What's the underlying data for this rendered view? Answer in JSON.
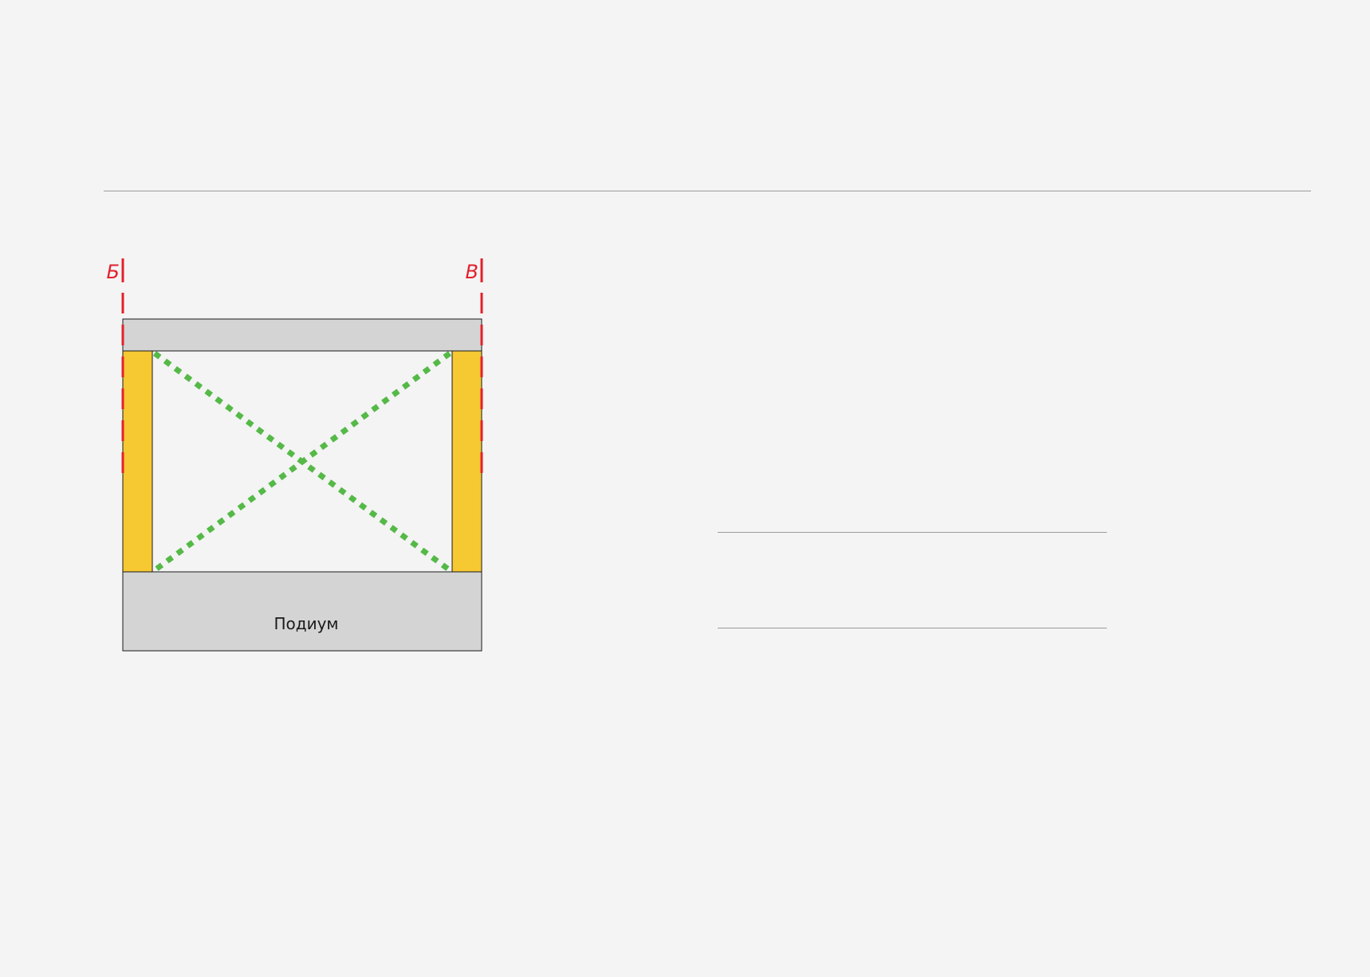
{
  "diagram": {
    "podium_label": "Подиум",
    "section_labels": {
      "left": "Б",
      "right": "В"
    }
  },
  "colors": {
    "background": "#f4f4f4",
    "podium_fill": "#d3d4d3",
    "outline": "#1a1a1a",
    "pillar_fill": "#f6c832",
    "diagonal_marker": "#55b947",
    "section_marker": "#e3202c",
    "text": "#1a1a1a",
    "rule": "#9a9a9a"
  }
}
